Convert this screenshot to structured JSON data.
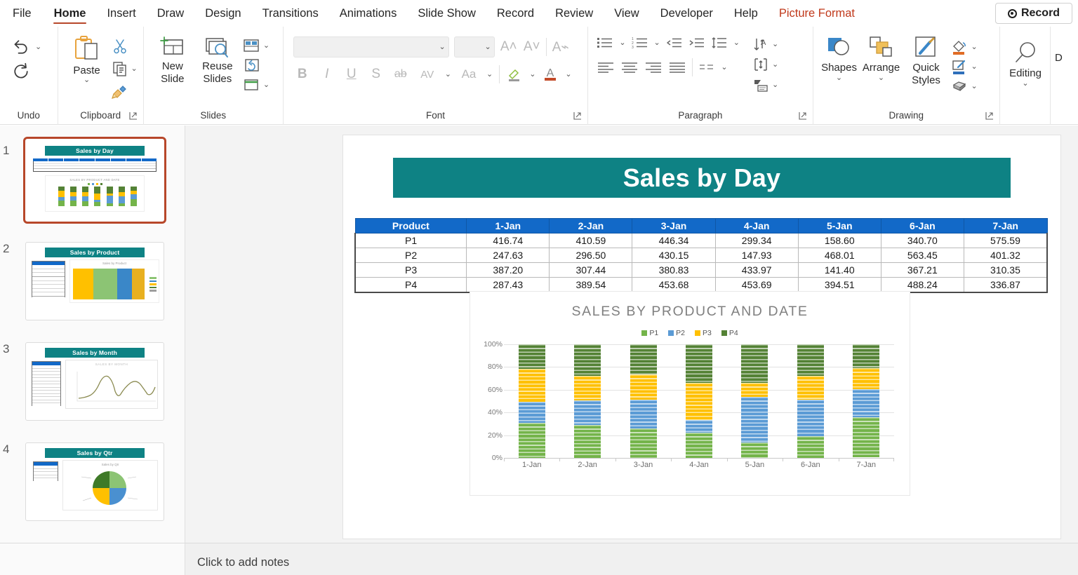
{
  "ribbon": {
    "tabs": [
      {
        "label": "File",
        "active": false,
        "contextual": false
      },
      {
        "label": "Home",
        "active": true,
        "contextual": false
      },
      {
        "label": "Insert",
        "active": false,
        "contextual": false
      },
      {
        "label": "Draw",
        "active": false,
        "contextual": false
      },
      {
        "label": "Design",
        "active": false,
        "contextual": false
      },
      {
        "label": "Transitions",
        "active": false,
        "contextual": false
      },
      {
        "label": "Animations",
        "active": false,
        "contextual": false
      },
      {
        "label": "Slide Show",
        "active": false,
        "contextual": false
      },
      {
        "label": "Record",
        "active": false,
        "contextual": false
      },
      {
        "label": "Review",
        "active": false,
        "contextual": false
      },
      {
        "label": "View",
        "active": false,
        "contextual": false
      },
      {
        "label": "Developer",
        "active": false,
        "contextual": false
      },
      {
        "label": "Help",
        "active": false,
        "contextual": false
      },
      {
        "label": "Picture Format",
        "active": false,
        "contextual": true
      }
    ],
    "record_button": "Record",
    "groups": {
      "undo": "Undo",
      "clipboard": "Clipboard",
      "slides": "Slides",
      "font": "Font",
      "paragraph": "Paragraph",
      "drawing": "Drawing"
    },
    "buttons": {
      "paste": "Paste",
      "new_slide": "New Slide",
      "reuse_slides": "Reuse Slides",
      "shapes": "Shapes",
      "arrange": "Arrange",
      "quick_styles": "Quick Styles",
      "editing": "Editing",
      "dictate": "D"
    },
    "font_name_value": "",
    "font_size_value": ""
  },
  "slide_panel": {
    "thumbnails": [
      {
        "number": "1",
        "title": "Sales by Day",
        "selected": true,
        "kind": "table-stacked-bar"
      },
      {
        "number": "2",
        "title": "Sales by Product",
        "selected": false,
        "kind": "table-treemap"
      },
      {
        "number": "3",
        "title": "Sales by Month",
        "selected": false,
        "kind": "table-line"
      },
      {
        "number": "4",
        "title": "Sales by Qtr",
        "selected": false,
        "kind": "table-pie"
      }
    ]
  },
  "slide": {
    "title": "Sales by Day",
    "title_bg": "#0e8284",
    "table": {
      "headers": [
        "Product",
        "1-Jan",
        "2-Jan",
        "3-Jan",
        "4-Jan",
        "5-Jan",
        "6-Jan",
        "7-Jan"
      ],
      "header_bg": "#1269c8",
      "rows": [
        [
          "P1",
          "416.74",
          "410.59",
          "446.34",
          "299.34",
          "158.60",
          "340.70",
          "575.59"
        ],
        [
          "P2",
          "247.63",
          "296.50",
          "430.15",
          "147.93",
          "468.01",
          "563.45",
          "401.32"
        ],
        [
          "P3",
          "387.20",
          "307.44",
          "380.83",
          "433.97",
          "141.40",
          "367.21",
          "310.35"
        ],
        [
          "P4",
          "287.43",
          "389.54",
          "453.68",
          "453.69",
          "394.51",
          "488.24",
          "336.87"
        ]
      ]
    }
  },
  "chart_data": {
    "type": "bar",
    "subtype": "100% stacked column",
    "title": "SALES BY PRODUCT AND DATE",
    "xlabel": "",
    "ylabel": "",
    "ylim": [
      0,
      100
    ],
    "ytick_labels": [
      "0%",
      "20%",
      "40%",
      "60%",
      "80%",
      "100%"
    ],
    "ytick_values": [
      0,
      20,
      40,
      60,
      80,
      100
    ],
    "grid": true,
    "legend_position": "top",
    "categories": [
      "1-Jan",
      "2-Jan",
      "3-Jan",
      "4-Jan",
      "5-Jan",
      "6-Jan",
      "7-Jan"
    ],
    "series": [
      {
        "name": "P1",
        "color": "#74b44a",
        "values": [
          416.74,
          410.59,
          446.34,
          299.34,
          158.6,
          340.7,
          575.59
        ],
        "percent": [
          32.2,
          29.6,
          26.4,
          22.9,
          13.6,
          20.2,
          35.3
        ]
      },
      {
        "name": "P2",
        "color": "#5b9bd5",
        "values": [
          247.63,
          296.5,
          430.15,
          147.93,
          468.01,
          563.45,
          401.32
        ],
        "percent": [
          19.1,
          21.4,
          25.5,
          11.3,
          40.2,
          33.4,
          24.6
        ]
      },
      {
        "name": "P3",
        "color": "#ffc000",
        "values": [
          387.2,
          307.44,
          380.83,
          433.97,
          141.4,
          367.21,
          310.35
        ],
        "percent": [
          29.9,
          22.2,
          22.5,
          33.2,
          12.1,
          21.8,
          19.0
        ]
      },
      {
        "name": "P4",
        "color": "#548235",
        "values": [
          287.43,
          389.54,
          453.68,
          453.69,
          394.51,
          488.24,
          336.87
        ],
        "percent": [
          22.2,
          28.1,
          26.9,
          34.7,
          33.9,
          28.9,
          20.7
        ]
      }
    ]
  },
  "notes": {
    "placeholder": "Click to add notes"
  }
}
